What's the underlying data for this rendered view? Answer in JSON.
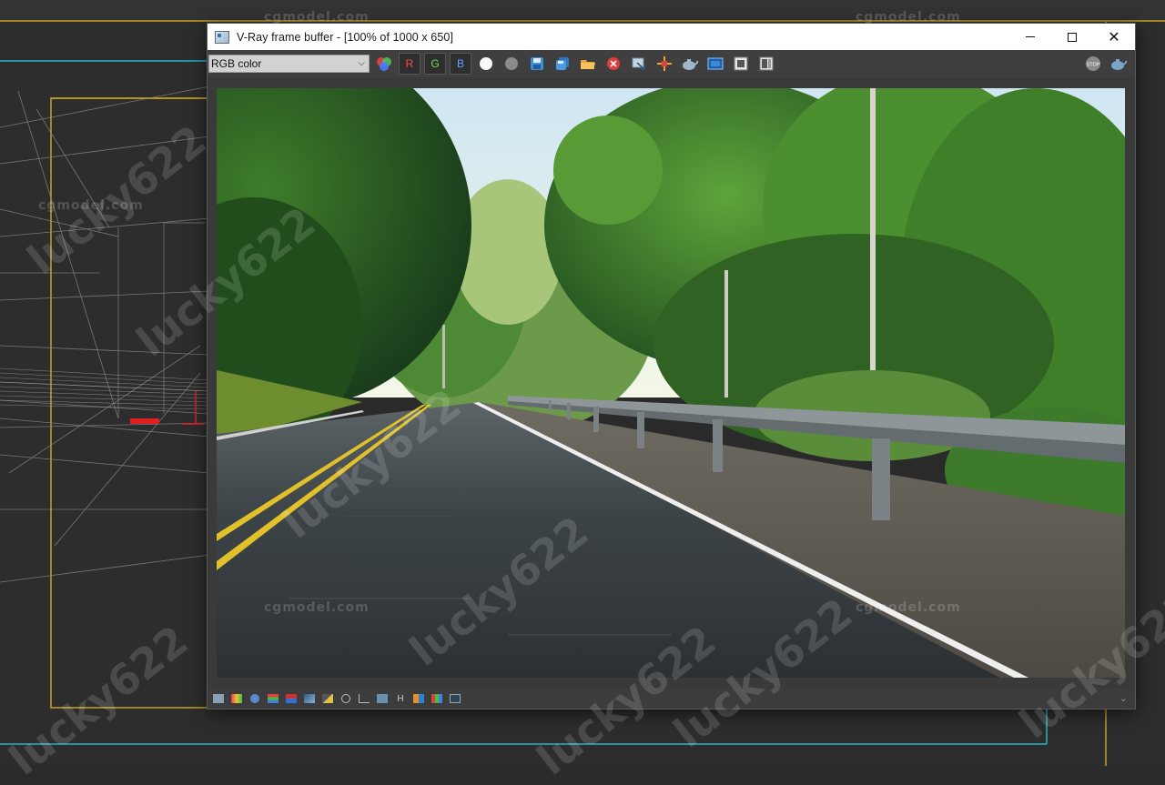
{
  "window": {
    "title": "V-Ray frame buffer - [100% of 1000 x 650]",
    "minimize_label": "",
    "maximize_label": "",
    "close_label": "✕"
  },
  "toolbar": {
    "channel_value": "RGB color",
    "channel_r": "R",
    "channel_g": "G",
    "channel_b": "B",
    "icons": [
      "channels-icon",
      "white-dot-icon",
      "grey-dot-icon",
      "save-icon",
      "save-all-icon",
      "open-icon",
      "clear-icon",
      "copy-to-max-icon",
      "track-mouse-icon",
      "render-teapot-icon",
      "region-icon",
      "lens-effects-icon",
      "compare-icon",
      "stop-icon",
      "teapot-icon"
    ],
    "stop_label": "STOP"
  },
  "statusbar": {
    "icons": [
      "display-icon",
      "histogram-icon",
      "info-icon",
      "levels-icon",
      "curves-icon",
      "exposure-icon",
      "correction-icon",
      "focus-icon",
      "graph-icon",
      "lut-icon",
      "hsv-icon",
      "compare-icon",
      "color-icon",
      "region-icon"
    ],
    "h_label": "H"
  },
  "watermarks": {
    "site": "cgmodel.com",
    "user": "lucky622"
  },
  "colors": {
    "accent_yellow": "#c9a227",
    "accent_cyan": "#23b5c7",
    "viewport_bg": "#2d2d2d"
  }
}
